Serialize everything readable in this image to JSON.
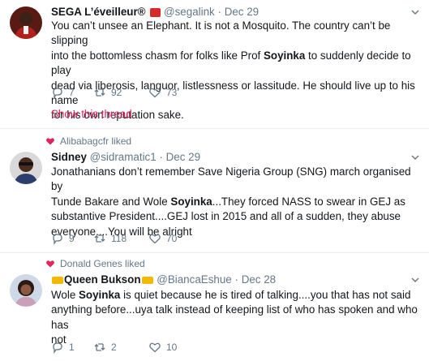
{
  "tweets": [
    {
      "social_context": "",
      "name": "SEGA L’éveilleur®",
      "handle": "@segalink",
      "time": "Dec 29",
      "text_lines": [
        [
          "You can’t unsee an Elephant. It is not a Mosquito. The country can’t be slipping",
          ""
        ],
        [
          "into the bottomless chasm for folks like Prof ",
          "Soyinka",
          " to suddenly decide to play"
        ],
        [
          "dead via liberosis, languor, listlessness or lassitude. He should live up to his name",
          ""
        ],
        [
          "for his own reputation sake.",
          ""
        ]
      ],
      "replies": "7",
      "retweets": "92",
      "likes": "73",
      "show_thread": "Show this thread"
    },
    {
      "social_context": "Alibabagcfr liked",
      "name": "Sidney",
      "handle": "@sidramatic1",
      "time": "Dec 29",
      "replies": "9",
      "retweets": "118",
      "likes": "70"
    },
    {
      "social_context": "Donald Genes liked",
      "name": "Queen Bukson",
      "handle": "@BiancaEshue",
      "time": "Dec 28",
      "replies": "1",
      "retweets": "2",
      "likes": "10"
    }
  ],
  "t1": {
    "l1": "You can’t unsee an Elephant. It is not a Mosquito. The country can’t be slipping",
    "l2a": "into the bottomless chasm for folks like Prof ",
    "l2b": "Soyinka",
    "l2c": " to suddenly decide to play",
    "l3": "dead via liberosis, languor, listlessness or lassitude. He should live up to his name",
    "l4": "for his own reputation sake."
  },
  "t2": {
    "l1": "Jonathanians don’t remember Save Nigeria Group (SNG) march organised by",
    "l2a": "Tunde Bakare and Wole ",
    "l2b": "Soyinka",
    "l2c": "...They forced NASS to swear in GEJ as",
    "l3": "substantive President....GEJ lost in 2015 and all of a sudden, they abuse",
    "l4": "everyone....You will be alright"
  },
  "t3": {
    "l1a": "Wole ",
    "l1b": "Soyinka",
    "l1c": " is quiet because he is tired of talking....you that has not said",
    "l2": "anything before...uya talk instead of keeping list of who has spoken and who has",
    "l3": "not"
  },
  "colors": {
    "like": "#e0245e",
    "muted": "#657786",
    "separator": "#e6ecf0"
  }
}
